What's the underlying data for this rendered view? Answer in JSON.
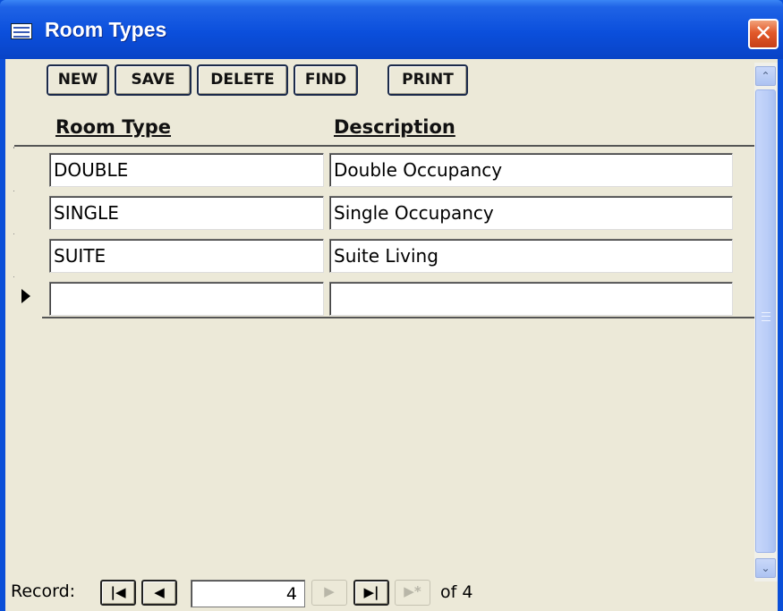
{
  "window": {
    "title": "Room Types",
    "title_icon": "form-icon",
    "close_glyph": "✕"
  },
  "toolbar": {
    "new_label": "NEW",
    "save_label": "SAVE",
    "delete_label": "DELETE",
    "find_label": "FIND",
    "print_label": "PRINT"
  },
  "columns": {
    "room_type": "Room Type",
    "description": "Description"
  },
  "rows": [
    {
      "room_type": "DOUBLE",
      "description": "Double Occupancy"
    },
    {
      "room_type": "SINGLE",
      "description": "Single Occupancy"
    },
    {
      "room_type": "SUITE",
      "description": "Suite Living"
    },
    {
      "room_type": "",
      "description": ""
    }
  ],
  "current_row_indicator": "arrow-right-icon",
  "navigation": {
    "label": "Record:",
    "first_glyph": "|◀",
    "prev_glyph": "◀",
    "current_record": "4",
    "next_glyph": "▶",
    "last_glyph": "▶|",
    "new_glyph": "▶*",
    "of_text": "of 4"
  },
  "colors": {
    "titlebar": "#0b4fdc",
    "client_bg": "#ece9d8",
    "close_button": "#e2592a"
  }
}
